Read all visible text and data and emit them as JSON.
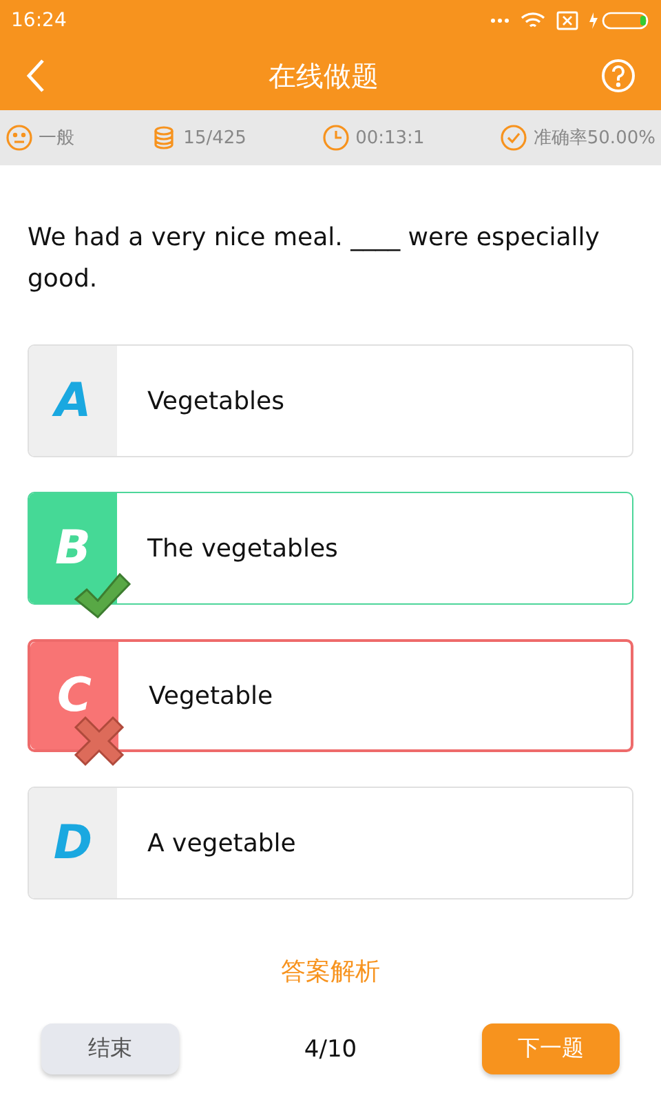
{
  "status_bar": {
    "time": "16:24"
  },
  "header": {
    "title": "在线做题"
  },
  "stats": [
    {
      "kind": "difficulty",
      "text": "一般"
    },
    {
      "kind": "progress",
      "text": "15/425"
    },
    {
      "kind": "timer",
      "text": "00:13:1"
    },
    {
      "kind": "accuracy",
      "text": "准确率50.00%"
    }
  ],
  "question": "We had a very nice meal. ____ were especially good.",
  "options": [
    {
      "letter": "A",
      "text": "Vegetables",
      "correct": false,
      "selected": false
    },
    {
      "letter": "B",
      "text": "The vegetables",
      "correct": true,
      "selected": false
    },
    {
      "letter": "C",
      "text": "Vegetable",
      "correct": false,
      "selected": true
    },
    {
      "letter": "D",
      "text": "A vegetable",
      "correct": false,
      "selected": false
    }
  ],
  "analysis_link": "答案解析",
  "footer": {
    "end_button": "结束",
    "page": "4/10",
    "next_button": "下一题"
  }
}
